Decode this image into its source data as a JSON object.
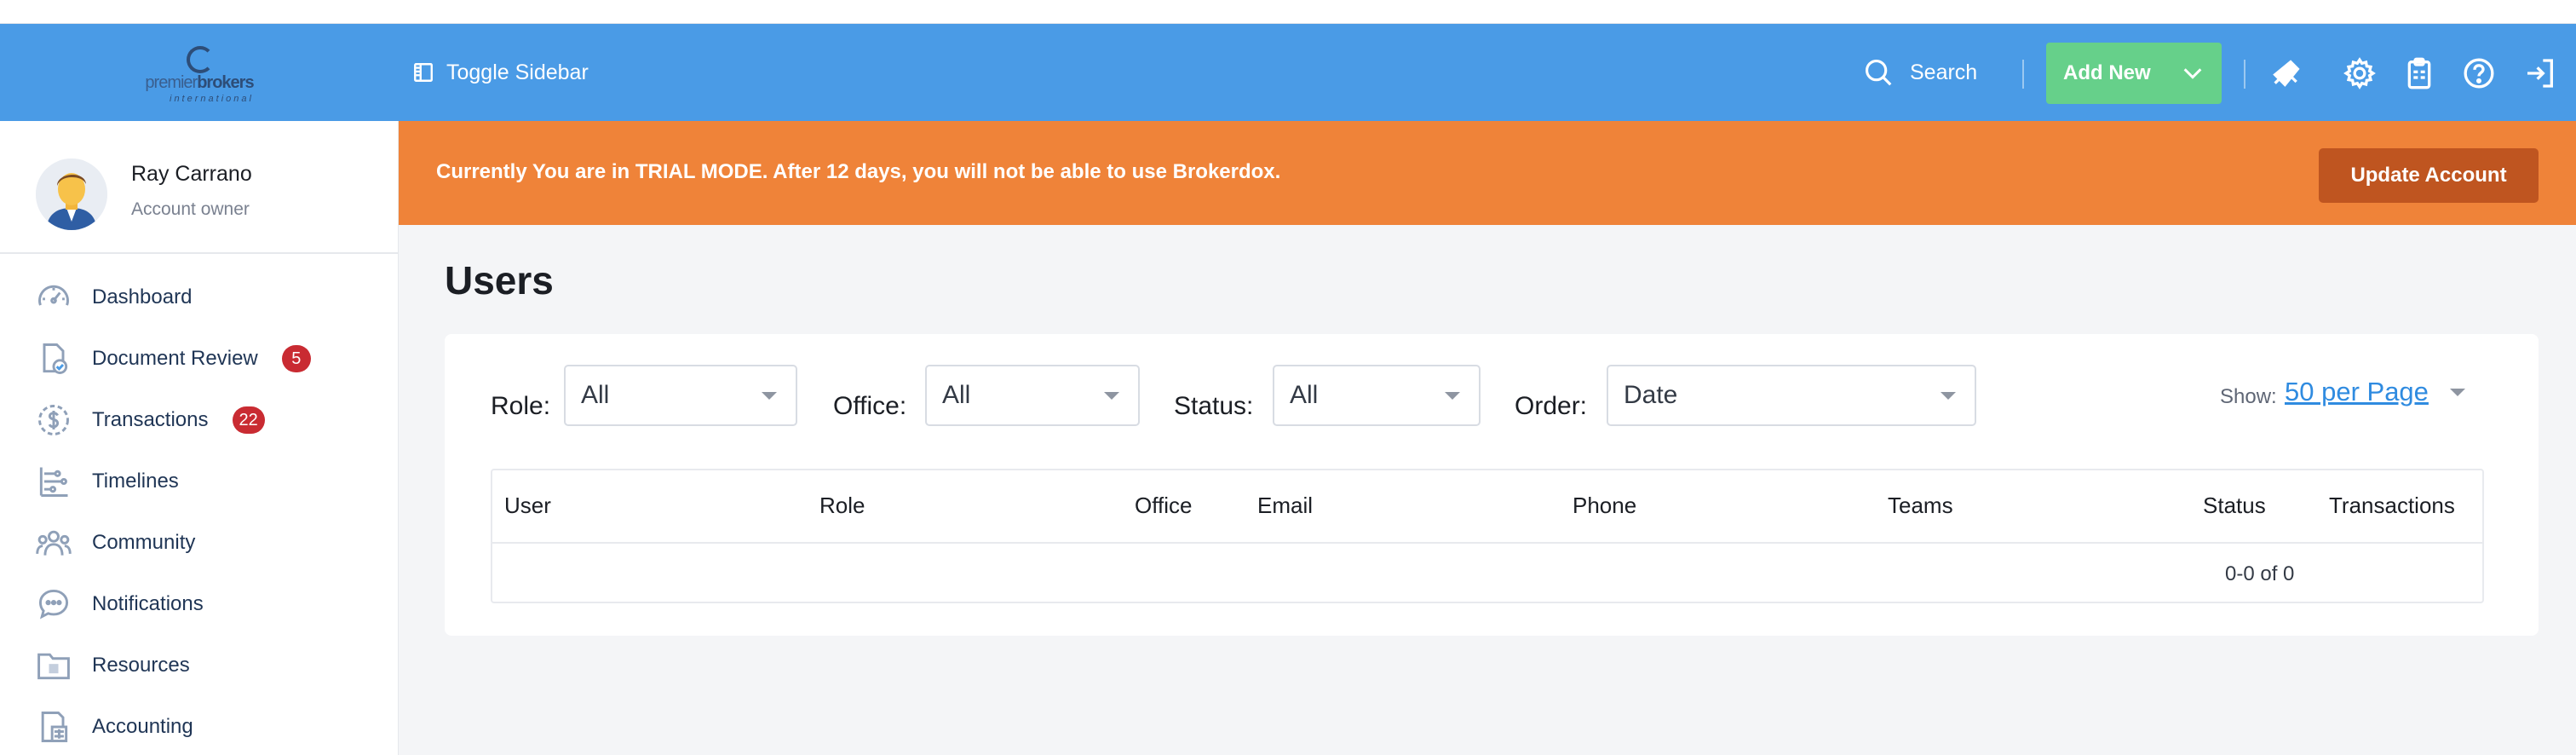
{
  "topbar": {
    "brand": {
      "name_light": "premier",
      "name_bold": "brokers",
      "subtitle": "international"
    },
    "toggle_label": "Toggle Sidebar",
    "search_label": "Search",
    "add_new_label": "Add New",
    "icons": [
      "megaphone-icon",
      "gear-icon",
      "clipboard-icon",
      "help-icon",
      "logout-icon"
    ],
    "color": "#4a9be6"
  },
  "user": {
    "name": "Ray Carrano",
    "role": "Account owner"
  },
  "sidebar": {
    "items": [
      {
        "label": "Dashboard",
        "icon": "speedometer-icon"
      },
      {
        "label": "Document Review",
        "icon": "document-check-icon",
        "badge": "5"
      },
      {
        "label": "Transactions",
        "icon": "dollar-circle-icon",
        "badge": "22"
      },
      {
        "label": "Timelines",
        "icon": "timeline-icon"
      },
      {
        "label": "Community",
        "icon": "people-icon"
      },
      {
        "label": "Notifications",
        "icon": "chat-bubble-icon"
      },
      {
        "label": "Resources",
        "icon": "folder-icon"
      },
      {
        "label": "Accounting",
        "icon": "calculator-icon"
      }
    ]
  },
  "trial": {
    "message": "Currently You are in TRIAL MODE. After 12 days, you will not be able to use Brokerdox.",
    "button": "Update Account",
    "color": "#ef8339"
  },
  "page": {
    "title": "Users"
  },
  "filters": {
    "role": {
      "label": "Role:",
      "value": "All"
    },
    "office": {
      "label": "Office:",
      "value": "All"
    },
    "status": {
      "label": "Status:",
      "value": "All"
    },
    "order": {
      "label": "Order:",
      "value": "Date"
    },
    "show": {
      "label": "Show:",
      "value": "50 per Page"
    }
  },
  "table": {
    "columns": [
      "User",
      "Role",
      "Office",
      "Email",
      "Phone",
      "Teams",
      "Status",
      "Transactions"
    ],
    "rows": [],
    "pagination": "0-0 of 0"
  }
}
